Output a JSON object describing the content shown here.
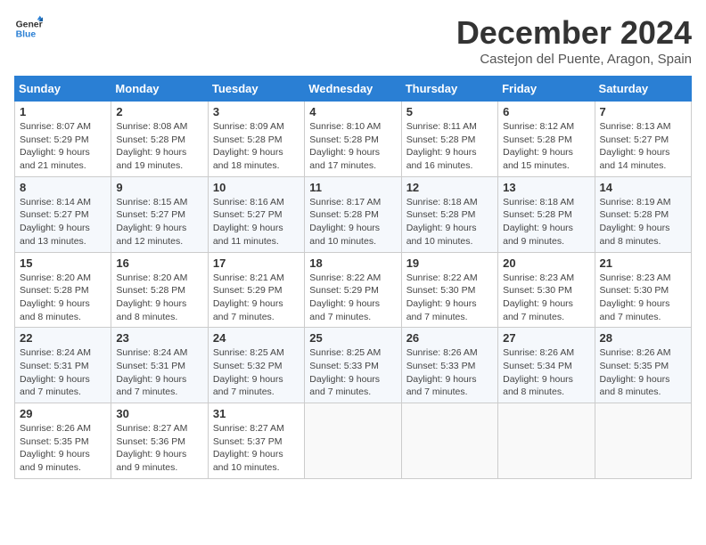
{
  "header": {
    "logo_general": "General",
    "logo_blue": "Blue",
    "month_title": "December 2024",
    "location": "Castejon del Puente, Aragon, Spain"
  },
  "days_of_week": [
    "Sunday",
    "Monday",
    "Tuesday",
    "Wednesday",
    "Thursday",
    "Friday",
    "Saturday"
  ],
  "weeks": [
    [
      {
        "day": "1",
        "info": "Sunrise: 8:07 AM\nSunset: 5:29 PM\nDaylight: 9 hours and 21 minutes."
      },
      {
        "day": "2",
        "info": "Sunrise: 8:08 AM\nSunset: 5:28 PM\nDaylight: 9 hours and 19 minutes."
      },
      {
        "day": "3",
        "info": "Sunrise: 8:09 AM\nSunset: 5:28 PM\nDaylight: 9 hours and 18 minutes."
      },
      {
        "day": "4",
        "info": "Sunrise: 8:10 AM\nSunset: 5:28 PM\nDaylight: 9 hours and 17 minutes."
      },
      {
        "day": "5",
        "info": "Sunrise: 8:11 AM\nSunset: 5:28 PM\nDaylight: 9 hours and 16 minutes."
      },
      {
        "day": "6",
        "info": "Sunrise: 8:12 AM\nSunset: 5:28 PM\nDaylight: 9 hours and 15 minutes."
      },
      {
        "day": "7",
        "info": "Sunrise: 8:13 AM\nSunset: 5:27 PM\nDaylight: 9 hours and 14 minutes."
      }
    ],
    [
      {
        "day": "8",
        "info": "Sunrise: 8:14 AM\nSunset: 5:27 PM\nDaylight: 9 hours and 13 minutes."
      },
      {
        "day": "9",
        "info": "Sunrise: 8:15 AM\nSunset: 5:27 PM\nDaylight: 9 hours and 12 minutes."
      },
      {
        "day": "10",
        "info": "Sunrise: 8:16 AM\nSunset: 5:27 PM\nDaylight: 9 hours and 11 minutes."
      },
      {
        "day": "11",
        "info": "Sunrise: 8:17 AM\nSunset: 5:28 PM\nDaylight: 9 hours and 10 minutes."
      },
      {
        "day": "12",
        "info": "Sunrise: 8:18 AM\nSunset: 5:28 PM\nDaylight: 9 hours and 10 minutes."
      },
      {
        "day": "13",
        "info": "Sunrise: 8:18 AM\nSunset: 5:28 PM\nDaylight: 9 hours and 9 minutes."
      },
      {
        "day": "14",
        "info": "Sunrise: 8:19 AM\nSunset: 5:28 PM\nDaylight: 9 hours and 8 minutes."
      }
    ],
    [
      {
        "day": "15",
        "info": "Sunrise: 8:20 AM\nSunset: 5:28 PM\nDaylight: 9 hours and 8 minutes."
      },
      {
        "day": "16",
        "info": "Sunrise: 8:20 AM\nSunset: 5:28 PM\nDaylight: 9 hours and 8 minutes."
      },
      {
        "day": "17",
        "info": "Sunrise: 8:21 AM\nSunset: 5:29 PM\nDaylight: 9 hours and 7 minutes."
      },
      {
        "day": "18",
        "info": "Sunrise: 8:22 AM\nSunset: 5:29 PM\nDaylight: 9 hours and 7 minutes."
      },
      {
        "day": "19",
        "info": "Sunrise: 8:22 AM\nSunset: 5:30 PM\nDaylight: 9 hours and 7 minutes."
      },
      {
        "day": "20",
        "info": "Sunrise: 8:23 AM\nSunset: 5:30 PM\nDaylight: 9 hours and 7 minutes."
      },
      {
        "day": "21",
        "info": "Sunrise: 8:23 AM\nSunset: 5:30 PM\nDaylight: 9 hours and 7 minutes."
      }
    ],
    [
      {
        "day": "22",
        "info": "Sunrise: 8:24 AM\nSunset: 5:31 PM\nDaylight: 9 hours and 7 minutes."
      },
      {
        "day": "23",
        "info": "Sunrise: 8:24 AM\nSunset: 5:31 PM\nDaylight: 9 hours and 7 minutes."
      },
      {
        "day": "24",
        "info": "Sunrise: 8:25 AM\nSunset: 5:32 PM\nDaylight: 9 hours and 7 minutes."
      },
      {
        "day": "25",
        "info": "Sunrise: 8:25 AM\nSunset: 5:33 PM\nDaylight: 9 hours and 7 minutes."
      },
      {
        "day": "26",
        "info": "Sunrise: 8:26 AM\nSunset: 5:33 PM\nDaylight: 9 hours and 7 minutes."
      },
      {
        "day": "27",
        "info": "Sunrise: 8:26 AM\nSunset: 5:34 PM\nDaylight: 9 hours and 8 minutes."
      },
      {
        "day": "28",
        "info": "Sunrise: 8:26 AM\nSunset: 5:35 PM\nDaylight: 9 hours and 8 minutes."
      }
    ],
    [
      {
        "day": "29",
        "info": "Sunrise: 8:26 AM\nSunset: 5:35 PM\nDaylight: 9 hours and 9 minutes."
      },
      {
        "day": "30",
        "info": "Sunrise: 8:27 AM\nSunset: 5:36 PM\nDaylight: 9 hours and 9 minutes."
      },
      {
        "day": "31",
        "info": "Sunrise: 8:27 AM\nSunset: 5:37 PM\nDaylight: 9 hours and 10 minutes."
      },
      {
        "day": "",
        "info": ""
      },
      {
        "day": "",
        "info": ""
      },
      {
        "day": "",
        "info": ""
      },
      {
        "day": "",
        "info": ""
      }
    ]
  ]
}
